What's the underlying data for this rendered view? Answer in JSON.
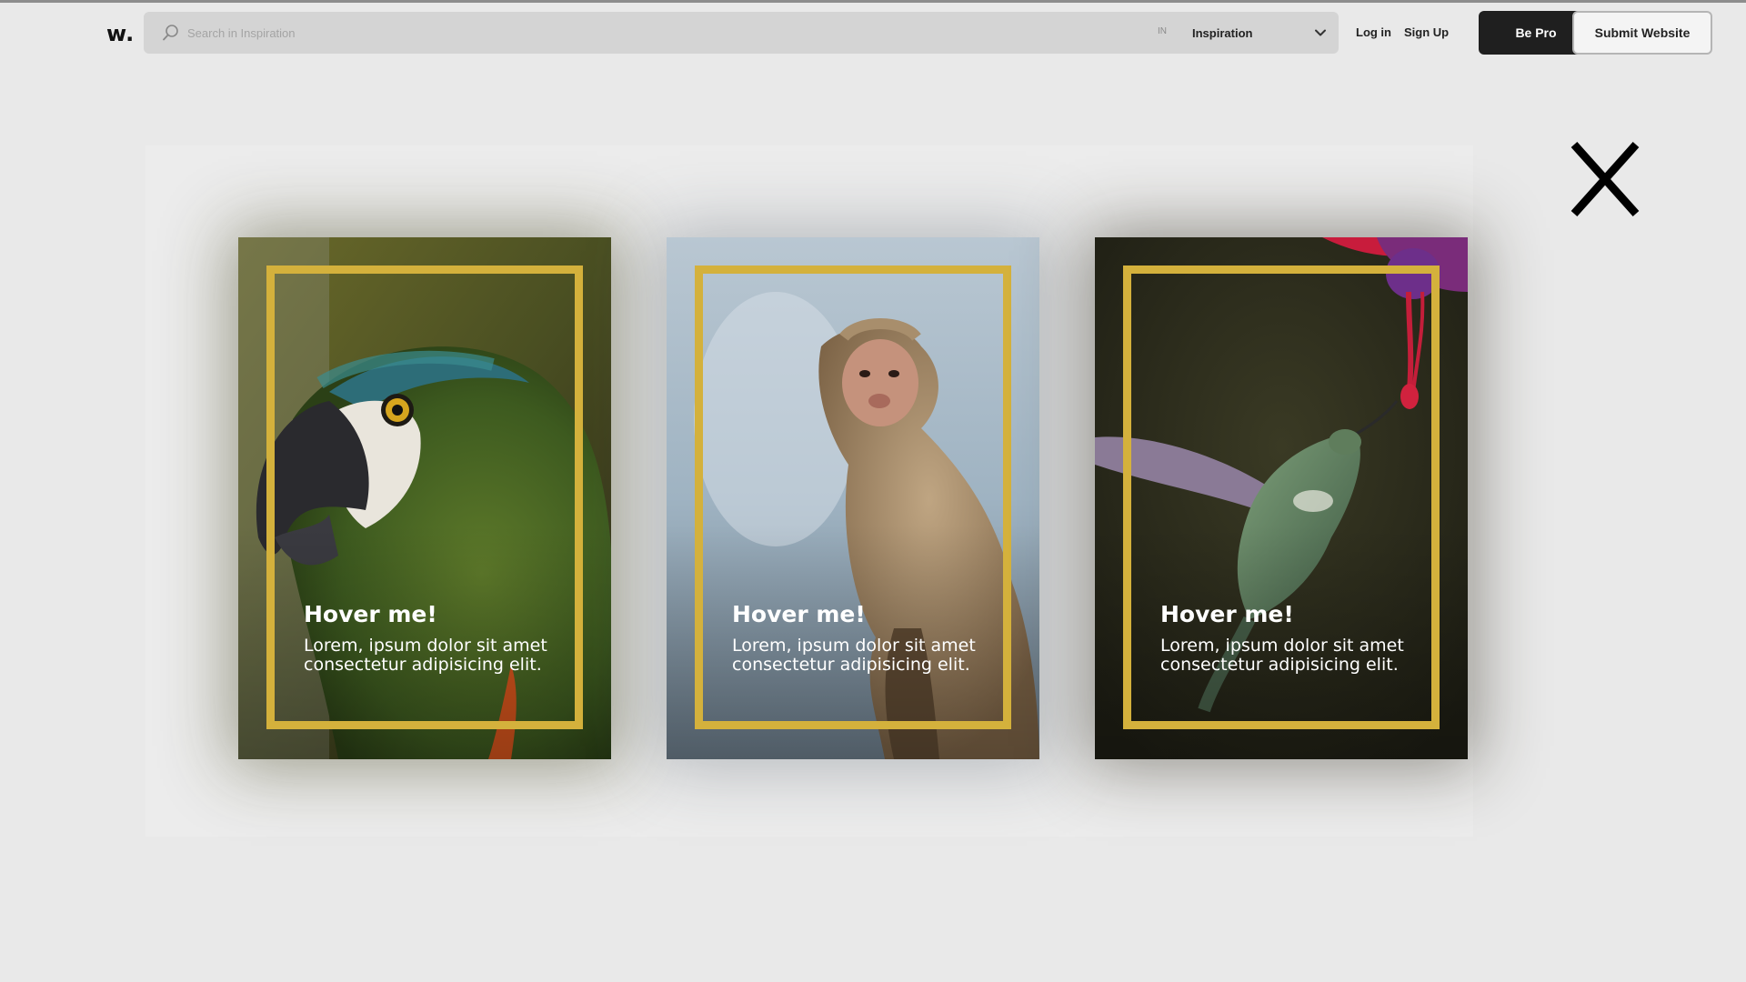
{
  "header": {
    "logo": "w.",
    "search": {
      "placeholder": "Search in Inspiration",
      "value": ""
    },
    "scope_prefix": "IN",
    "scope_value": "Inspiration",
    "login_label": "Log in",
    "signup_label": "Sign Up",
    "bepro_label": "Be Pro",
    "submit_label": "Submit Website"
  },
  "close_icon": "close-icon",
  "cards": [
    {
      "title": "Hover me!",
      "body": "Lorem, ipsum dolor sit amet consectetur adipisicing elit.",
      "image": "parrot"
    },
    {
      "title": "Hover me!",
      "body": "Lorem, ipsum dolor sit amet consectetur adipisicing elit.",
      "image": "monkey"
    },
    {
      "title": "Hover me!",
      "body": "Lorem, ipsum dolor sit amet consectetur adipisicing elit.",
      "image": "hummingbird"
    }
  ],
  "colors": {
    "frame": "#d4b13c",
    "primary_button": "#1f1f1f",
    "background": "#e9e9e9"
  }
}
